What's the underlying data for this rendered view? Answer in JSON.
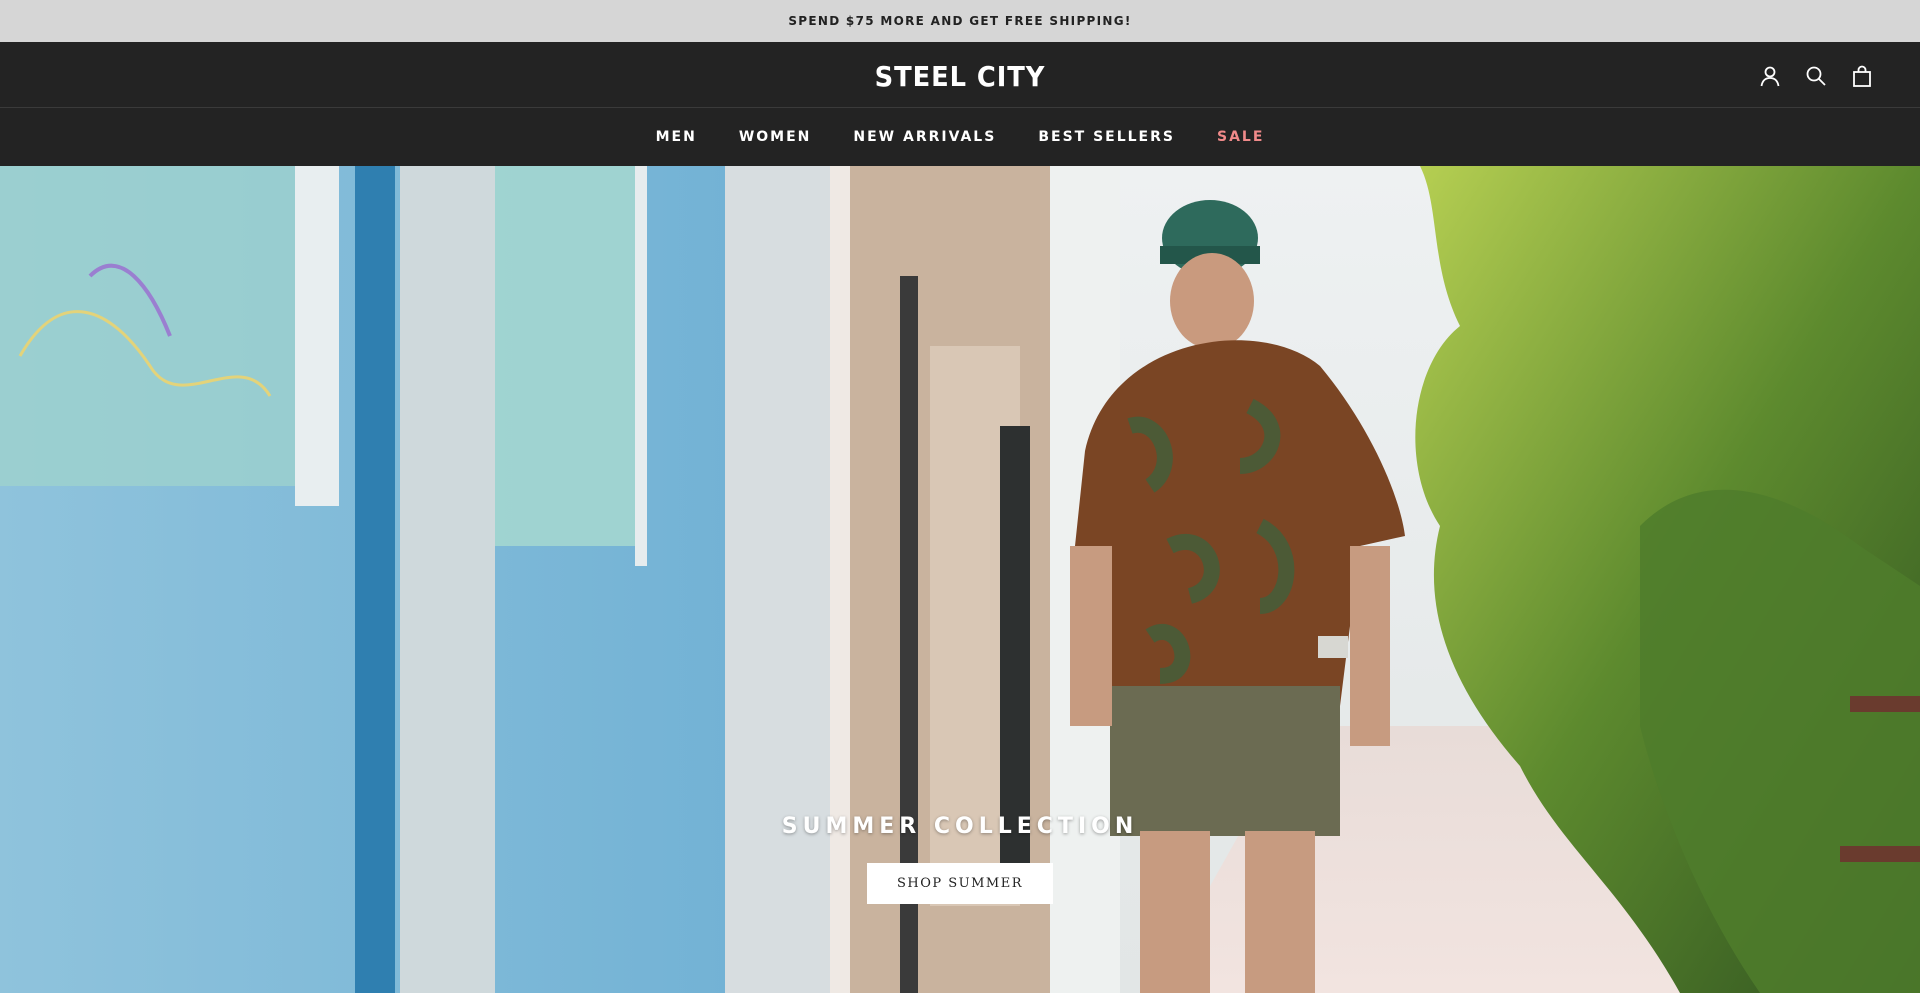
{
  "announcement": {
    "text": "SPEND $75 MORE AND GET FREE SHIPPING!"
  },
  "header": {
    "logo": "STEEL CITY",
    "icons": [
      "account-icon",
      "search-icon",
      "cart-icon"
    ]
  },
  "nav": {
    "items": [
      {
        "label": "MEN"
      },
      {
        "label": "WOMEN"
      },
      {
        "label": "NEW ARRIVALS"
      },
      {
        "label": "BEST SELLERS"
      },
      {
        "label": "SALE"
      }
    ]
  },
  "hero": {
    "title": "SUMMER COLLECTION",
    "button_label": "SHOP SUMMER"
  },
  "colors": {
    "announcement_bg": "#d6d6d6",
    "header_bg": "#232323",
    "sale_accent": "#f08a8a"
  }
}
